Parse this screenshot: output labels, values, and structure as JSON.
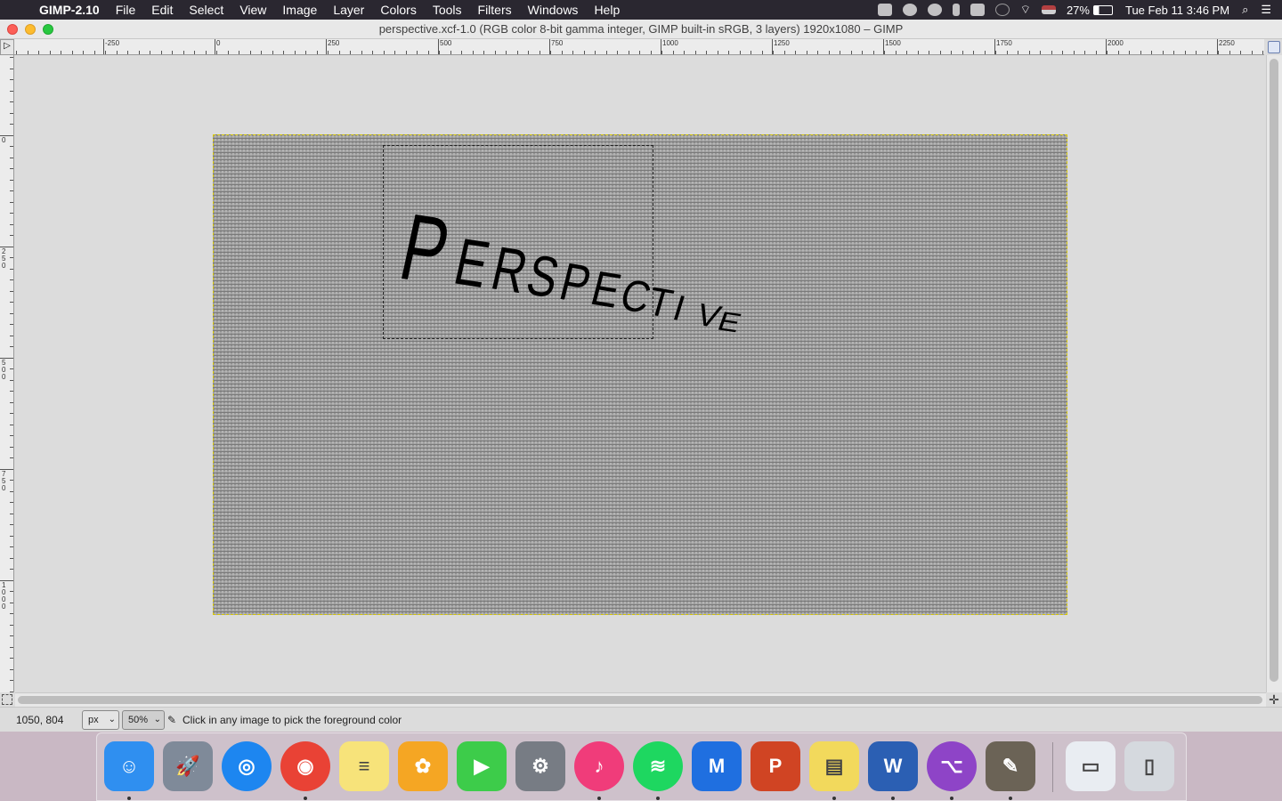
{
  "menubar": {
    "app_name": "GIMP-2.10",
    "items": [
      "File",
      "Edit",
      "Select",
      "View",
      "Image",
      "Layer",
      "Colors",
      "Tools",
      "Filters",
      "Windows",
      "Help"
    ],
    "battery": "27%",
    "clock": "Tue Feb 11  3:46 PM"
  },
  "window": {
    "title": "perspective.xcf-1.0 (RGB color 8-bit gamma integer, GIMP built-in sRGB, 3 layers) 1920x1080 – GIMP"
  },
  "rulers": {
    "horizontal": [
      "-250",
      "0",
      "250",
      "500",
      "750",
      "1000",
      "1250",
      "1500",
      "1750",
      "2000",
      "2250"
    ],
    "vertical": [
      "0",
      "250",
      "500",
      "750",
      "1000"
    ]
  },
  "canvas": {
    "layer_text": "PERSPECTIVE"
  },
  "statusbar": {
    "coords": "1050, 804",
    "unit": "px",
    "zoom": "50%",
    "message": "Click in any image to pick the foreground color"
  },
  "dock": {
    "apps": [
      {
        "name": "finder",
        "color": "#2f8ff0",
        "running": true
      },
      {
        "name": "launchpad",
        "color": "#7f8a99",
        "running": false
      },
      {
        "name": "safari",
        "color": "#1d86f0",
        "running": false
      },
      {
        "name": "chrome",
        "color": "#e94235",
        "running": true
      },
      {
        "name": "notes",
        "color": "#f7e37a",
        "running": false
      },
      {
        "name": "photos",
        "color": "#f5a623",
        "running": false
      },
      {
        "name": "facetime",
        "color": "#3dcc4a",
        "running": false
      },
      {
        "name": "system-preferences",
        "color": "#777c84",
        "running": false
      },
      {
        "name": "itunes",
        "color": "#f03c7a",
        "running": true
      },
      {
        "name": "spotify",
        "color": "#1ed760",
        "running": true
      },
      {
        "name": "malwarebytes",
        "color": "#1f6fe0",
        "running": false
      },
      {
        "name": "powerpoint",
        "color": "#d04423",
        "running": false
      },
      {
        "name": "stickies",
        "color": "#f2d95c",
        "running": true
      },
      {
        "name": "word",
        "color": "#2b5fb3",
        "running": true
      },
      {
        "name": "github-desktop",
        "color": "#8e44c7",
        "running": true
      },
      {
        "name": "gimp",
        "color": "#6b6356",
        "running": true
      },
      {
        "name": "recent-document",
        "color": "#e9edf2",
        "running": false
      },
      {
        "name": "trash",
        "color": "#d5d9de",
        "running": false
      }
    ]
  }
}
